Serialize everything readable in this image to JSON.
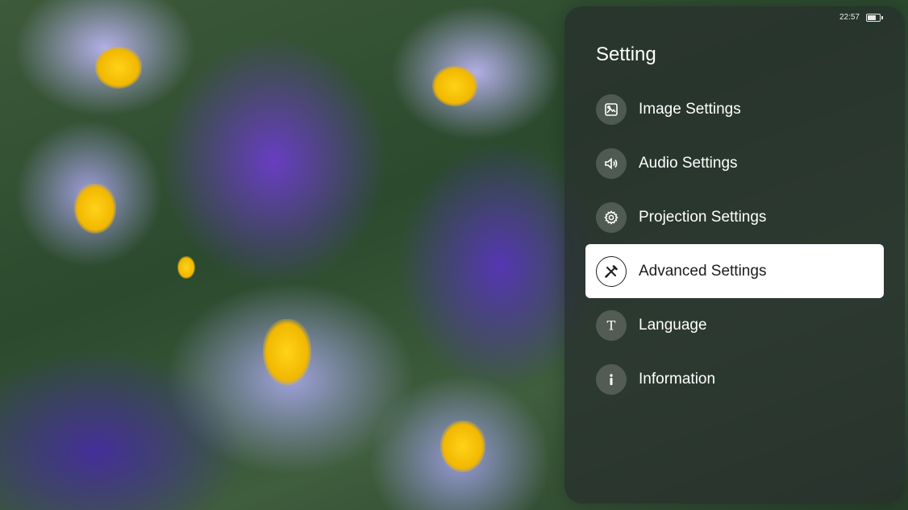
{
  "status_bar": {
    "time": "22:57",
    "battery_icon": "battery-icon"
  },
  "panel": {
    "title": "Setting",
    "items": [
      {
        "label": "Image Settings",
        "icon": "image-icon",
        "active": false
      },
      {
        "label": "Audio Settings",
        "icon": "speaker-icon",
        "active": false
      },
      {
        "label": "Projection Settings",
        "icon": "gear-icon",
        "active": false
      },
      {
        "label": "Advanced Settings",
        "icon": "tools-icon",
        "active": true
      },
      {
        "label": "Language",
        "icon": "text-t-icon",
        "active": false
      },
      {
        "label": "Information",
        "icon": "info-icon",
        "active": false
      }
    ]
  },
  "colors": {
    "highlight": "#ffffff",
    "panel_bg": "#28302d",
    "text": "#ffffff",
    "active_text": "#1c1c1c"
  }
}
